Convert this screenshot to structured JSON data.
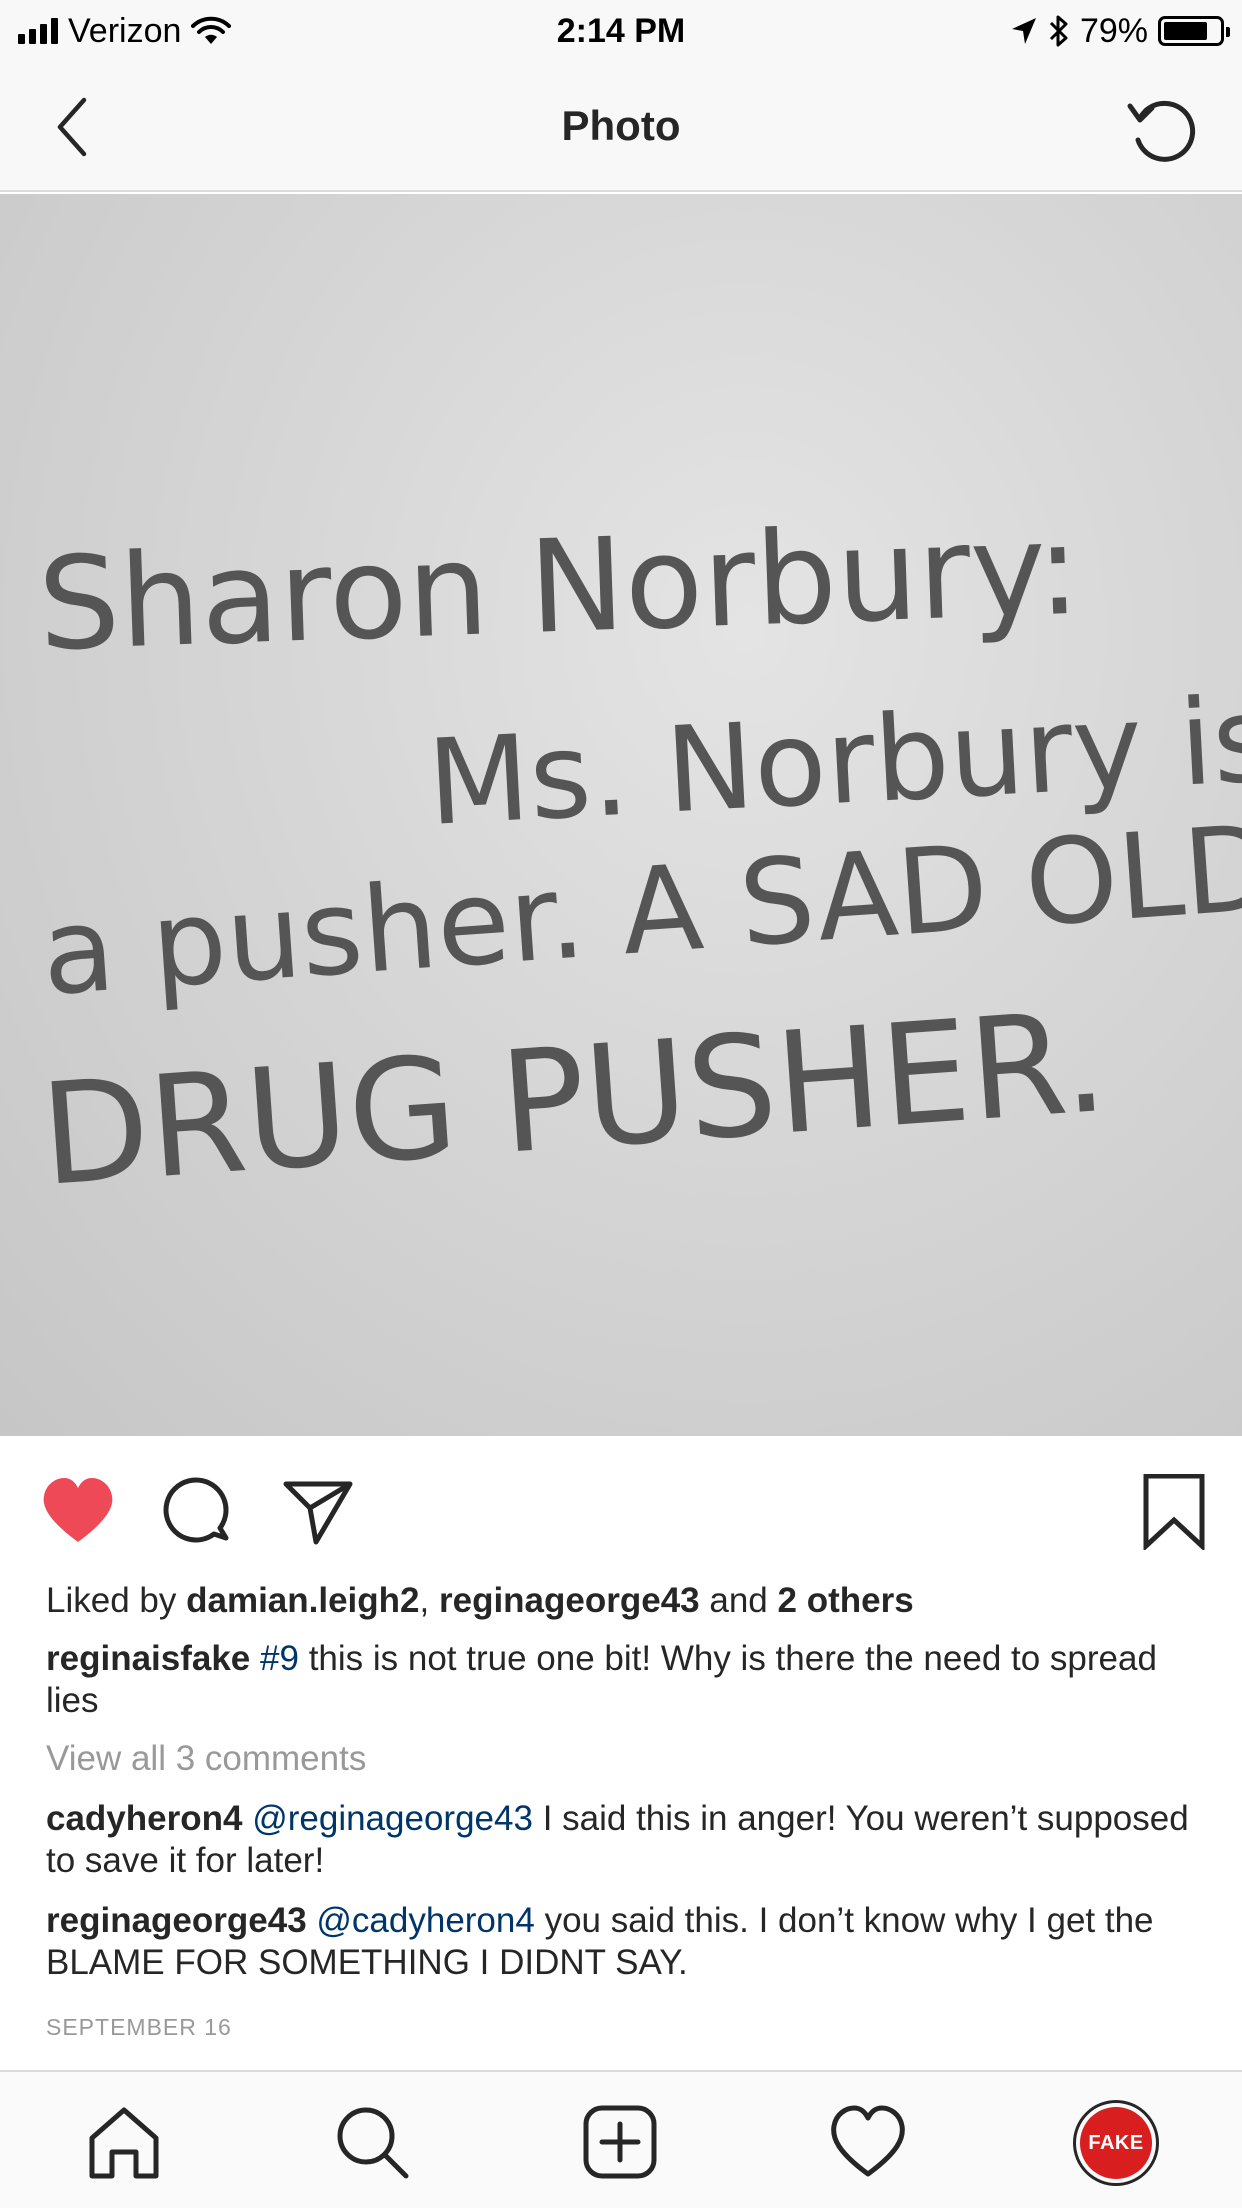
{
  "status_bar": {
    "carrier": "Verizon",
    "time": "2:14 PM",
    "battery": "79%",
    "battery_level": 0.79
  },
  "nav": {
    "title": "Photo"
  },
  "photo": {
    "line1": "Sharon Norbury:",
    "line2": "Ms. Norbury is",
    "line3": "a pusher. A SAD OLD",
    "line4": "DRUG PUSHER."
  },
  "post": {
    "likes_prefix": "Liked by",
    "liker1": "damian.leigh2",
    "separator": ",",
    "liker2": "reginageorge43",
    "and_text": "and",
    "others": "2 others",
    "caption": {
      "user": "reginaisfake",
      "hashtag": "#9",
      "text": "this is not true one bit! Why is there the need to spread lies"
    },
    "view_all": "View all 3 comments",
    "comments": [
      {
        "user": "cadyheron4",
        "mention": "@reginageorge43",
        "text": "I said this in anger! You weren’t supposed to save it for later!"
      },
      {
        "user": "reginageorge43",
        "mention": "@cadyheron4",
        "text": "you said this. I don’t know why I get the BLAME FOR SOMETHING I DIDNT SAY."
      }
    ],
    "date": "SEPTEMBER 16"
  },
  "tab_bar": {
    "profile_label": "FAKE"
  },
  "colors": {
    "like_red": "#ed4956",
    "link_blue": "#003569",
    "muted_gray": "#999999",
    "profile_red": "#d81e1e"
  }
}
